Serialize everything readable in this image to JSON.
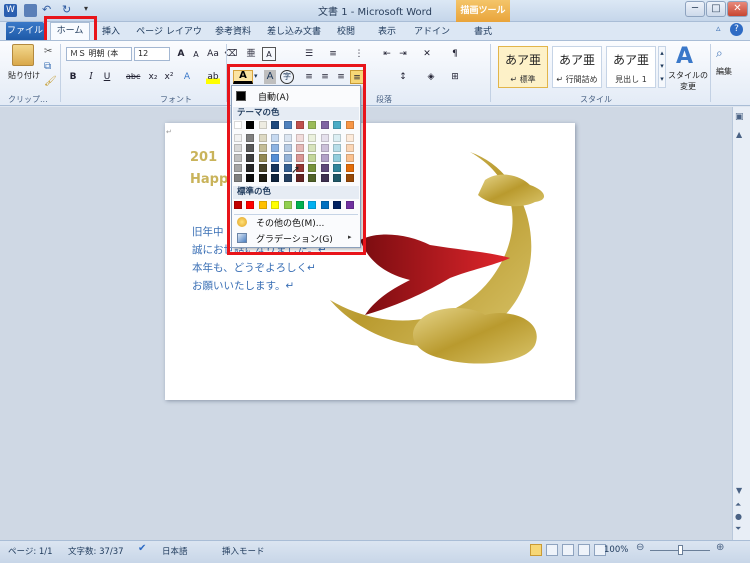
{
  "window": {
    "title": "文書 1 - Microsoft Word",
    "context_tab": "描画ツール"
  },
  "tabs": [
    "ファイル",
    "ホーム",
    "挿入",
    "ページ レイアウト",
    "参考資料",
    "差し込み文書",
    "校閲",
    "表示",
    "アドイン",
    "書式"
  ],
  "font": {
    "name": "ＭＳ 明朝 (本",
    "size": "12"
  },
  "groups": {
    "clipboard": "クリップ...",
    "font": "フォント",
    "paragraph": "段落",
    "styles": "スタイル"
  },
  "clipboard": {
    "paste": "貼り付け"
  },
  "styles": [
    {
      "sample": "あア亜",
      "name": "↵ 標準"
    },
    {
      "sample": "あア亜",
      "name": "↵ 行間詰め"
    },
    {
      "sample": "あア亜",
      "name": "見出し 1"
    }
  ],
  "style_change": "スタイルの\n変更",
  "edit": "編集",
  "dropdown": {
    "auto": "自動(A)",
    "theme_header": "テーマの色",
    "standard_header": "標準の色",
    "more_colors": "その他の色(M)...",
    "gradient": "グラデーション(G)"
  },
  "colors": {
    "theme_top": [
      "#ffffff",
      "#000000",
      "#eeece1",
      "#1f497d",
      "#4f81bd",
      "#c0504d",
      "#9bbb59",
      "#8064a2",
      "#4bacc6",
      "#f79646"
    ],
    "theme_shades": [
      [
        "#f2f2f2",
        "#7f7f7f",
        "#ddd9c3",
        "#c6d9f0",
        "#dbe5f1",
        "#f2dcdb",
        "#ebf1dd",
        "#e5e0ec",
        "#dbeef3",
        "#fdeada"
      ],
      [
        "#d8d8d8",
        "#595959",
        "#c4bd97",
        "#8db3e2",
        "#b8cce4",
        "#e5b9b7",
        "#d7e3bc",
        "#ccc1d9",
        "#b7dde8",
        "#fbd5b5"
      ],
      [
        "#bfbfbf",
        "#3f3f3f",
        "#938953",
        "#548dd4",
        "#95b3d7",
        "#d99694",
        "#c3d69b",
        "#b2a2c7",
        "#92cddc",
        "#fac08f"
      ],
      [
        "#a5a5a5",
        "#262626",
        "#494429",
        "#17365d",
        "#366092",
        "#953734",
        "#76923c",
        "#5f497a",
        "#31859b",
        "#e36c09"
      ],
      [
        "#7f7f7f",
        "#0c0c0c",
        "#1d1b10",
        "#0f243e",
        "#244061",
        "#632423",
        "#4f6128",
        "#3f3151",
        "#205867",
        "#974806"
      ]
    ],
    "standard": [
      "#c00000",
      "#ff0000",
      "#ffc000",
      "#ffff00",
      "#92d050",
      "#00b050",
      "#00b0f0",
      "#0070c0",
      "#002060",
      "#7030a0"
    ]
  },
  "document": {
    "heading1": "201",
    "heading2": "Happ",
    "lines": [
      "旧年中",
      "誠にお世話になりました。↵",
      "本年も、どうぞよろしく↵",
      "お願いいたします。↵"
    ]
  },
  "status": {
    "page": "ページ: 1/1",
    "words": "文字数: 37/37",
    "lang": "日本語",
    "mode": "挿入モード",
    "zoom": "100%"
  }
}
